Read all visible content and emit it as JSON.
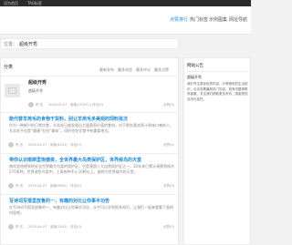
{
  "topbar": {
    "left_text": "设为首页",
    "right_text": "TAG标签"
  },
  "header": {
    "nav": [
      {
        "label": "点赞排行",
        "active": true
      },
      {
        "label": "热门标签",
        "active": false
      },
      {
        "label": "示例图集",
        "active": false
      },
      {
        "label": "网址导航",
        "active": false
      }
    ]
  },
  "breadcrumb": {
    "prefix": "位置：",
    "current": "超级开秀"
  },
  "main": {
    "section_title": "分类",
    "sort_options": [
      "最新发布",
      "最多浏览",
      "最多评论",
      "最多点赞"
    ],
    "items": [
      {
        "title": "超级开秀",
        "subtitle": "超级开秀",
        "desc": "",
        "author": "佚 名",
        "date": "2020-04-07",
        "views": "阅读(107471)",
        "comments": "评论(0)",
        "likes": "点赞(0)"
      },
      {
        "title": "能代替羊羔毛的食物干货料，别让羊羔毛多美观的饲料批次",
        "subtitle": "",
        "desc": "作为一种新兴的日常饮食，羊羔毛已被发掘出大量营养价值的食材。对于那些喜欢原汁原味口感的人，羊羔毛不仅是“健康”但也“美味”，同时也在饮食中有重要地位。",
        "author": "佚 名",
        "date": "2020-04-07",
        "views": "阅读(4101)",
        "comments": "评论(0)",
        "likes": "点赞(0)"
      },
      {
        "title": "带你认识南岸里饱德泉，全世界最大鸟类保护区，世界候鸟的天堂",
        "subtitle": "",
        "desc": "南岸里饱德泉地处全世界最大鸟类的保护区，它是我国十大自然保护区之一，30年来已累计观察到候鸟270多种，世界濒危鸟类中，上乘有种不止10种以上，被称为世界候鸟的天堂。",
        "author": "佚 名",
        "date": "2020-04-07",
        "views": "阅读(6961)",
        "comments": "评论(0)",
        "likes": "点赞(0)"
      },
      {
        "title": "写诗词写报里放鲁的一，有趣的对比让你事半功告",
        "subtitle": "",
        "desc": "在写诗词写报里放鲁的一，有趣对比让你事半功告，从中可以学到很多知识，让我们一起来看看下面的内容吧。",
        "author": "佚 名",
        "date": "2020-04-07",
        "views": "阅读(3441)",
        "comments": "评论(0)",
        "likes": "点赞(0)"
      }
    ]
  },
  "sidebar": {
    "title": "网站公告",
    "name": "超级开秀",
    "desc": "我们专注原创优质内容，分享精彩的生活知识，点击查看最新热门内容，如有问题请联系客服。关注我们获取更多资讯，感谢您的支持与信任。"
  }
}
